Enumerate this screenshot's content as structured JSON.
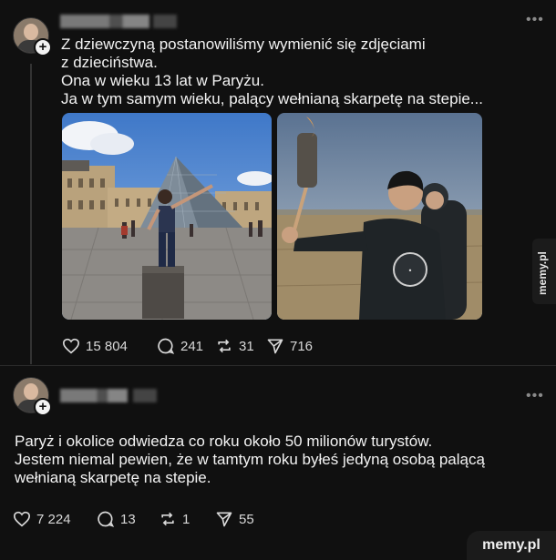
{
  "post1": {
    "text_lines": [
      "Z dziewczyną postanowiliśmy wymienić się zdjęciami",
      "z dzieciństwa.",
      "Ona w wieku 13 lat w Paryżu.",
      "Ja w tym samym wieku, palący wełnianą skarpetę na stepie..."
    ],
    "likes": "15 804",
    "comments": "241",
    "reposts": "31",
    "shares": "716"
  },
  "post2": {
    "text_lines": [
      "Paryż i okolice odwiedza co roku około 50 milionów turystów.",
      "Jestem niemal pewien, że w tamtym roku byłeś jedyną osobą palącą",
      "wełnianą skarpetę na stepie."
    ],
    "likes": "7 224",
    "comments": "13",
    "reposts": "1",
    "shares": "55"
  },
  "watermark": {
    "side": "memy.pl",
    "corner": "memy.pl"
  },
  "icons": [
    "heart-icon",
    "comment-icon",
    "repost-icon",
    "share-icon",
    "more-icon",
    "plus-icon"
  ],
  "colors": {
    "background": "#101010",
    "text": "#f3f3f3",
    "muted": "#8a8a8a"
  }
}
